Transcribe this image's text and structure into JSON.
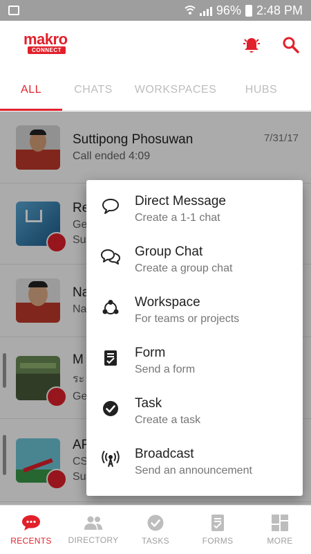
{
  "status_bar": {
    "battery": "96%",
    "time": "2:48 PM"
  },
  "app": {
    "logo_word": "makro",
    "logo_tag": "CONNECT"
  },
  "tabs": [
    {
      "label": "ALL",
      "active": true
    },
    {
      "label": "CHATS",
      "active": false
    },
    {
      "label": "WORKSPACES",
      "active": false
    },
    {
      "label": "HUBS",
      "active": false
    }
  ],
  "conversations": [
    {
      "name": "Suttipong Phosuwan",
      "line1": "Call ended 4:09",
      "line2": "",
      "date": "7/31/17"
    },
    {
      "name": "Re",
      "line1": "Ge",
      "line2": "Su",
      "date": ""
    },
    {
      "name": "Na",
      "line1": "Na",
      "line2": "",
      "date": ""
    },
    {
      "name": "M",
      "line1": "ระ",
      "line2": "Ge",
      "date": ""
    },
    {
      "name": "AR",
      "line1": "CS",
      "line2": "Su",
      "date": ""
    }
  ],
  "menu": [
    {
      "title": "Direct Message",
      "desc": "Create a 1-1 chat",
      "icon": "chat-bubble-icon"
    },
    {
      "title": "Group Chat",
      "desc": "Create a group chat",
      "icon": "group-chat-icon"
    },
    {
      "title": "Workspace",
      "desc": "For teams or projects",
      "icon": "workspace-icon"
    },
    {
      "title": "Form",
      "desc": "Send a form",
      "icon": "form-icon"
    },
    {
      "title": "Task",
      "desc": "Create a task",
      "icon": "task-check-icon"
    },
    {
      "title": "Broadcast",
      "desc": "Send an announcement",
      "icon": "broadcast-icon"
    }
  ],
  "bottom_nav": [
    {
      "label": "RECENTS",
      "active": true
    },
    {
      "label": "DIRECTORY",
      "active": false
    },
    {
      "label": "TASKS",
      "active": false
    },
    {
      "label": "FORMS",
      "active": false
    },
    {
      "label": "MORE",
      "active": false
    }
  ],
  "colors": {
    "accent": "#e1202b",
    "inactive": "#bdbdbd"
  }
}
